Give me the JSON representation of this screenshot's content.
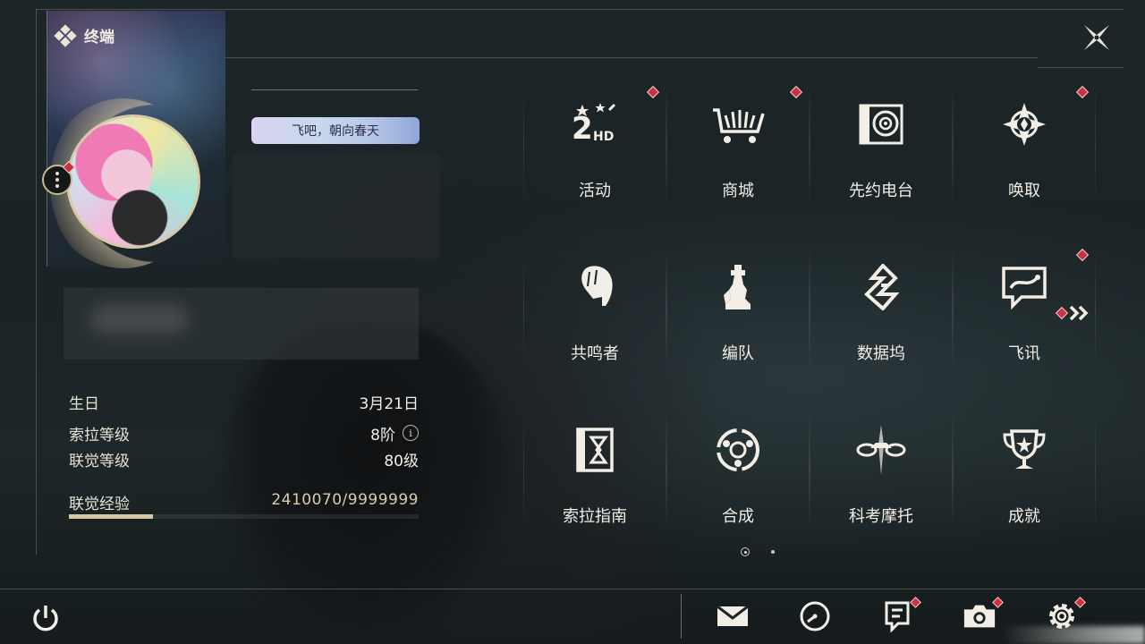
{
  "header": {
    "title": "终端"
  },
  "profile": {
    "title_badge": "飞吧，朝向春天"
  },
  "stats": [
    {
      "label": "生日",
      "value": "3月21日"
    },
    {
      "label": "索拉等级",
      "value": "8阶"
    },
    {
      "label": "联觉等级",
      "value": "80级"
    }
  ],
  "exp": {
    "label": "联觉经验",
    "value": "2410070/9999999",
    "progress": 0.241
  },
  "menu": [
    {
      "label": "活动",
      "icon": "event-2hd-icon",
      "badge": true
    },
    {
      "label": "商城",
      "icon": "shop-cart-icon",
      "badge": true
    },
    {
      "label": "先约电台",
      "icon": "radio-icon",
      "badge": false
    },
    {
      "label": "唤取",
      "icon": "compass-star-icon",
      "badge": true
    },
    {
      "label": "共鸣者",
      "icon": "resonator-head-icon",
      "badge": false
    },
    {
      "label": "编队",
      "icon": "chess-team-icon",
      "badge": false
    },
    {
      "label": "数据坞",
      "icon": "data-dock-icon",
      "badge": false
    },
    {
      "label": "飞讯",
      "icon": "chat-message-icon",
      "badge": true
    },
    {
      "label": "索拉指南",
      "icon": "guide-book-icon",
      "badge": false
    },
    {
      "label": "合成",
      "icon": "synthesis-icon",
      "badge": false
    },
    {
      "label": "科考摩托",
      "icon": "motorbike-icon",
      "badge": false
    },
    {
      "label": "成就",
      "icon": "trophy-icon",
      "badge": false
    }
  ],
  "bottom_bar": [
    {
      "icon": "mail-icon",
      "badge": false
    },
    {
      "icon": "clock-icon",
      "badge": false
    },
    {
      "icon": "notice-icon",
      "badge": true
    },
    {
      "icon": "camera-icon",
      "badge": true
    },
    {
      "icon": "settings-gear-icon",
      "badge": true
    }
  ],
  "colors": {
    "accent": "#d8c7a0",
    "badge_red": "#c93442",
    "background": "#1b2427"
  }
}
